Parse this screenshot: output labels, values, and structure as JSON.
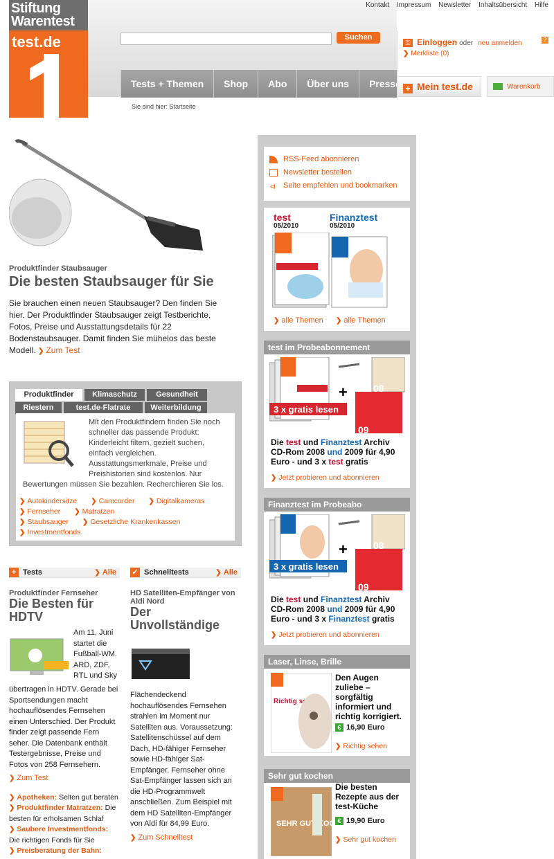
{
  "header": {
    "logo_line1": "Stiftung",
    "logo_line2": "Warentest",
    "logo_domain": "test.de",
    "top_links": [
      "Kontakt",
      "Impressum",
      "Newsletter",
      "Inhaltsübersicht",
      "Hilfe"
    ],
    "search_button": "Suchen",
    "search_value": "",
    "nav": [
      "Tests + Themen",
      "Shop",
      "Abo",
      "Über uns",
      "Presse"
    ],
    "breadcrumb": "Sie sind hier: Startseite",
    "login_label": "Einloggen",
    "login_or": "oder",
    "register_label": "neu anmelden",
    "merkliste": "Merkliste (0)",
    "help": "?",
    "mein_test": "Mein test.de",
    "warenkorb": "Warenkorb"
  },
  "hero": {
    "kicker": "Produktfinder Staubsauger",
    "title": "Die besten Staubsauger für Sie",
    "text": "Sie brauchen einen neuen Staubsauger? Den finden Sie hier. Der Produktfinder Staubsauger zeigt Testberichte, Fotos, Preise und Ausstattungsdetails für 22 Bodenstaubsauger. Damit finden Sie mühelos das beste Modell.",
    "link": "Zum Test"
  },
  "produktfinder": {
    "tabs_row1": [
      "Produktfinder",
      "Klimaschutz",
      "Gesundheit"
    ],
    "tabs_row2": [
      "Riestern",
      "test.de-Flatrate",
      "Weiterbildung"
    ],
    "text": "Mit den Produktfindern finden Sie noch schneller das passende Produkt: Kinderleicht filtern, gezielt suchen, einfach vergleichen. Ausstattungsmerkmale, Preise und Preishistorien sind kostenlos. Nur Bewertungen müssen Sie bezahlen. Recherchieren Sie los.",
    "links": [
      "Autokindersitze",
      "Camcorder",
      "Digitalkameras",
      "Fernseher",
      "Matratzen",
      "Staubsauger",
      "Gesetzliche Krankenkassen",
      "Investmentfonds"
    ]
  },
  "tests": {
    "head": "Tests",
    "alle": "Alle",
    "kicker": "Produktfinder Fernseher",
    "title": "Die Besten für HDTV",
    "text_short": "Am 11. Juni startet die Fußball-WM. ARD, ZDF, RTL und Sky",
    "text_long": "übertragen in HDTV. Gerade bei Sportsendungen macht hochauflösendes Fernsehen einen Unterschied. Der Produkt finder zeigt passende Fern seher. Die Datenbank enthält Testergebnisse, Preise und Fotos von 258 Fernsehern.",
    "link": "Zum Test",
    "more": [
      {
        "title": "Apotheken:",
        "text": "Selten gut beraten"
      },
      {
        "title": "Produktfinder Matratzen:",
        "text": "Die besten für erholsamen Schlaf"
      },
      {
        "title": "Saubere Investmentfonds:",
        "text": "Die richtigen Fonds für Sie"
      },
      {
        "title": "Preisberatung der Bahn:",
        "text": ""
      }
    ]
  },
  "schnelltests": {
    "head": "Schnelltests",
    "alle": "Alle",
    "kicker": "HD Satelliten-Empfänger von Aldi Nord",
    "title": "Der Unvollständige",
    "text": "Flächendeckend hochauflösendes Fernsehen strahlen im Moment nur Satelliten aus. Voraussetzung: Satellitenschüssel auf dem Dach, HD-fähiger Fernseher sowie HD-fähiger Sat-Empfänger. Fernseher ohne Sat-Empfänger lassen sich an die HD-Programmwelt anschließen. Zum Beispiel mit dem HD Satelliten-Empfänger von Aldi für 84,99 Euro.",
    "link": "Zum Schnelltest"
  },
  "sidebar": {
    "links": [
      "RSS-Feed abonnieren",
      "Newsletter bestellen",
      "Seite empfehlen und bookmarken"
    ],
    "mag1_name": "test",
    "mag1_issue": "05/2010",
    "mag2_name": "Finanztest",
    "mag2_issue": "05/2010",
    "mag_link": "alle Themen",
    "probe1_head": "test im Probeabonnement",
    "probe1_text": [
      "Die ",
      "test",
      " und ",
      "Finanztest",
      " Archiv CD-Rom 2008 ",
      "und",
      " 2009 für 4,90 Euro - und 3 x ",
      "test",
      " gratis"
    ],
    "probe1_badge": "3 x gratis lesen",
    "probe1_link": "Jetzt probieren und abonnieren",
    "probe2_head": "Finanztest im Probeabo",
    "probe2_text": [
      "Die ",
      "test",
      " und ",
      "Finanztest",
      " Archiv CD-Rom 2008 ",
      "und",
      " 2009 für 4,90 Euro - und 3 x ",
      "Finanztest",
      " gratis"
    ],
    "probe2_badge": "3 x gratis lesen",
    "probe2_link": "Jetzt probieren und abonnieren",
    "book1_head": "Laser, Linse, Brille",
    "book1_text": "Den Augen zuliebe – sorgfältig informiert und richtig korrigiert.",
    "book1_price": "16,90 Euro",
    "book1_link": "Richtig sehen",
    "book1_cover": "Richtig sehen",
    "book2_head": "Sehr gut kochen",
    "book2_text": "Die besten Rezepte aus der test-Küche",
    "book2_price": "19,90 Euro",
    "book2_link": "Sehr gut kochen",
    "book2_cover": "SEHR GUT KOCHEN",
    "euro": "€",
    "plus": "+",
    "badge_num1": "08",
    "badge_num2": "09"
  }
}
